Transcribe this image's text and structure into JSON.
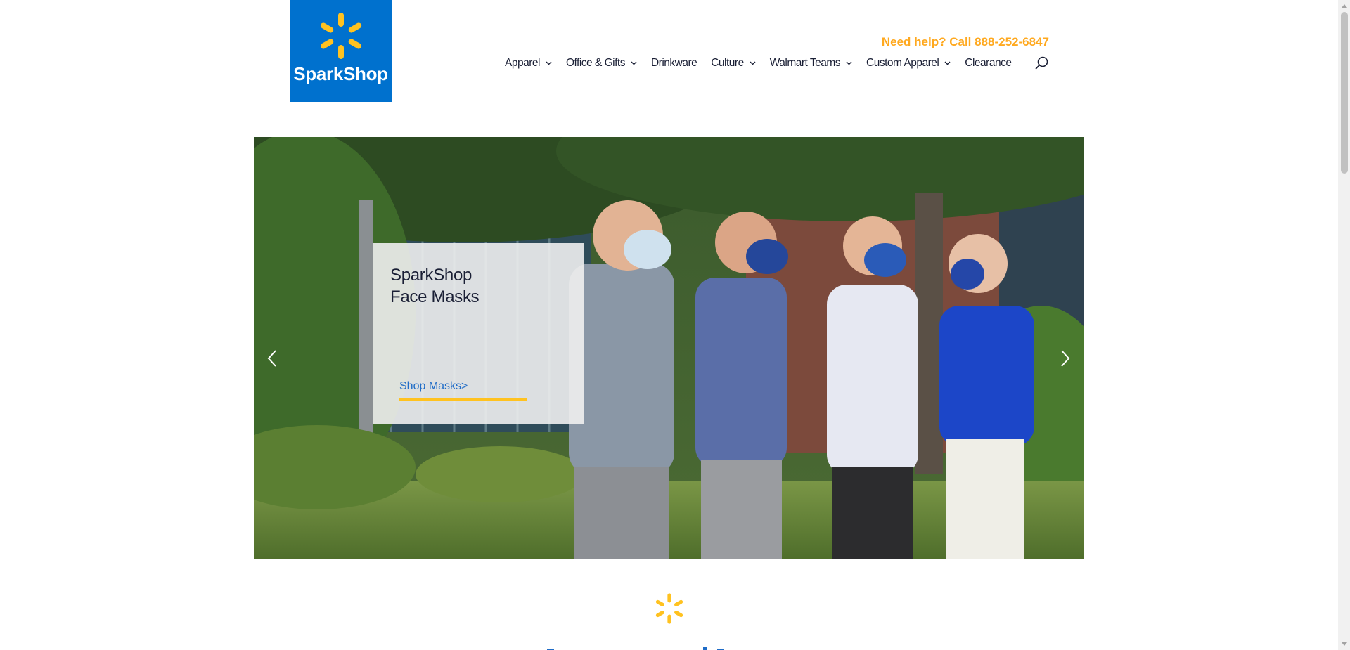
{
  "header": {
    "logo_text": "SparkShop",
    "help_text": "Need help? Call 888-252-6847"
  },
  "nav": {
    "items": [
      {
        "label": "Apparel",
        "has_dropdown": true
      },
      {
        "label": "Office & Gifts",
        "has_dropdown": true
      },
      {
        "label": "Drinkware",
        "has_dropdown": false
      },
      {
        "label": "Culture",
        "has_dropdown": true
      },
      {
        "label": "Walmart Teams",
        "has_dropdown": true
      },
      {
        "label": "Custom Apparel",
        "has_dropdown": true
      },
      {
        "label": "Clearance",
        "has_dropdown": false
      }
    ],
    "search_icon": "search-icon"
  },
  "hero": {
    "title_line1": "SparkShop",
    "title_line2": "Face Masks",
    "cta": "Shop Masks>",
    "prev_icon": "chevron-left-icon",
    "next_icon": "chevron-right-icon"
  },
  "colors": {
    "brand_blue": "#0071ce",
    "spark_yellow": "#ffc220",
    "help_orange": "#ffa91f",
    "nav_text": "#1a1f35",
    "cta_blue": "#1f6cc7"
  }
}
